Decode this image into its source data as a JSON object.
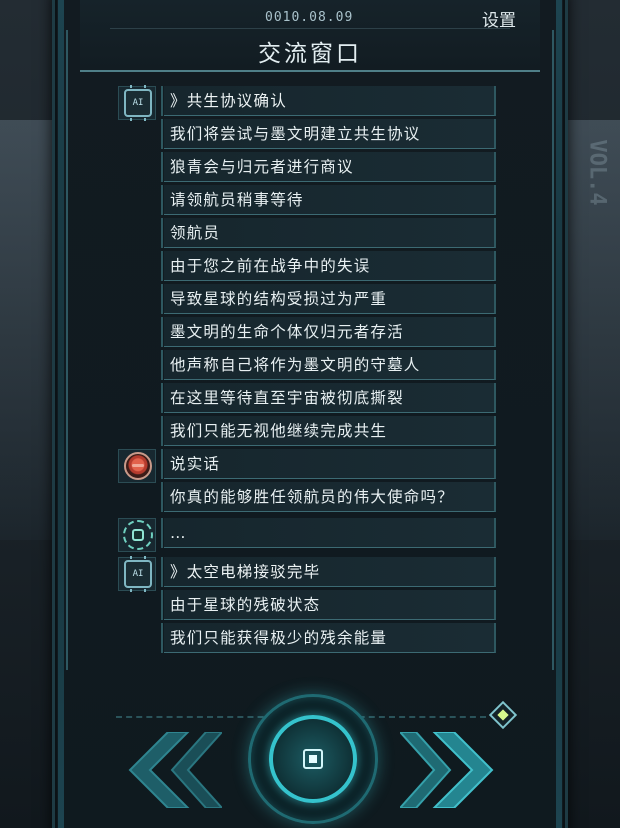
{
  "header": {
    "date": "0010.08.09",
    "settings_label": "设置",
    "title": "交流窗口"
  },
  "dialog": [
    {
      "speaker": "ai-chip",
      "lines": [
        "》共生协议确认",
        "我们将尝试与墨文明建立共生协议",
        "狼青会与归元者进行商议",
        "请领航员稍事等待",
        "领航员",
        "由于您之前在战争中的失误",
        "导致星球的结构受损过为严重",
        "墨文明的生命个体仅归元者存活",
        "他声称自己将作为墨文明的守墓人",
        "在这里等待直至宇宙被彻底撕裂",
        "我们只能无视他继续完成共生"
      ]
    },
    {
      "speaker": "red-creature",
      "lines": [
        "说实话",
        "你真的能够胜任领航员的伟大使命吗？"
      ]
    },
    {
      "speaker": "green-chip",
      "lines": [
        "…"
      ]
    },
    {
      "speaker": "ai-chip",
      "lines": [
        "》太空电梯接驳完毕",
        "由于星球的残破状态",
        "我们只能获得极少的残余能量"
      ]
    }
  ],
  "icons": {
    "chip_label": "AI"
  },
  "colors": {
    "accent": "#35c3cd",
    "text": "#e8f0f2",
    "panel": "#1a2c34"
  },
  "side_text": "VOL.4"
}
